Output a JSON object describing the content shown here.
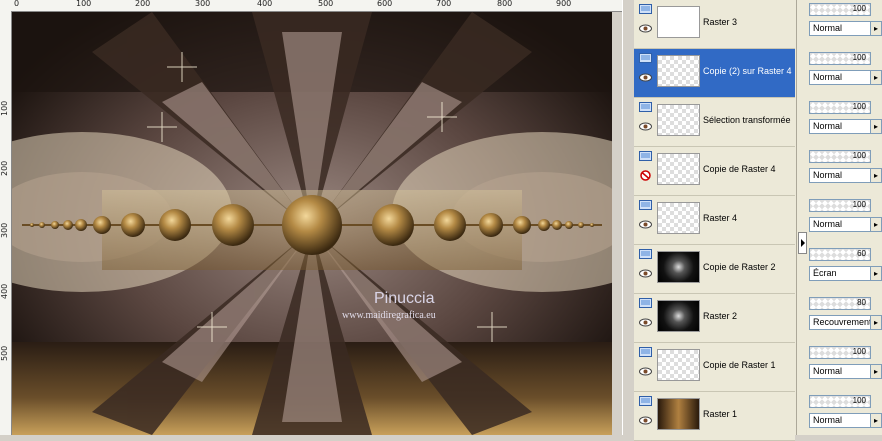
{
  "ruler": {
    "top_labels": [
      "0",
      "100",
      "200",
      "300",
      "400",
      "500",
      "600",
      "700",
      "800",
      "900"
    ],
    "left_labels": [
      "100",
      "200",
      "300",
      "400",
      "500"
    ]
  },
  "canvas": {
    "watermark_title": "Pinuccia",
    "watermark_url": "www.maidiregrafica.eu",
    "colors": {
      "accent_gold": "#a07a3c",
      "mauve": "#8c7570",
      "dark": "#1e1510"
    }
  },
  "layers": [
    {
      "name": "Raster 3",
      "selected": false,
      "visible": true,
      "thumb": "beads",
      "opacity": "100",
      "blend": "Normal"
    },
    {
      "name": "Copie (2) sur Raster 4",
      "selected": true,
      "visible": true,
      "thumb": "empty",
      "opacity": "100",
      "blend": "Normal"
    },
    {
      "name": "Sélection transformée",
      "selected": false,
      "visible": true,
      "thumb": "empty",
      "opacity": "100",
      "blend": "Normal"
    },
    {
      "name": "Copie de Raster 4",
      "selected": false,
      "visible": false,
      "thumb": "empty",
      "opacity": "100",
      "blend": "Normal"
    },
    {
      "name": "Raster 4",
      "selected": false,
      "visible": true,
      "thumb": "empty",
      "opacity": "100",
      "blend": "Normal"
    },
    {
      "name": "Copie de Raster 2",
      "selected": false,
      "visible": true,
      "thumb": "dark-star",
      "opacity": "60",
      "blend": "Écran"
    },
    {
      "name": "Raster 2",
      "selected": false,
      "visible": true,
      "thumb": "dark-star",
      "opacity": "80",
      "blend": "Recouvrement"
    },
    {
      "name": "Copie de Raster 1",
      "selected": false,
      "visible": true,
      "thumb": "bottom-stripe",
      "opacity": "100",
      "blend": "Normal"
    },
    {
      "name": "Raster 1",
      "selected": false,
      "visible": true,
      "thumb": "brown-pattern",
      "opacity": "100",
      "blend": "Normal"
    }
  ]
}
